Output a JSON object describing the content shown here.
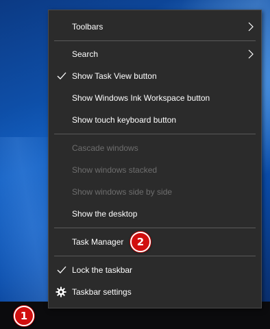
{
  "menu": {
    "items": [
      {
        "label": "Toolbars",
        "submenu": true
      },
      {
        "label": "Search",
        "submenu": true
      },
      {
        "label": "Show Task View button",
        "checked": true
      },
      {
        "label": "Show Windows Ink Workspace button"
      },
      {
        "label": "Show touch keyboard button"
      },
      {
        "label": "Cascade windows",
        "disabled": true
      },
      {
        "label": "Show windows stacked",
        "disabled": true
      },
      {
        "label": "Show windows side by side",
        "disabled": true
      },
      {
        "label": "Show the desktop"
      },
      {
        "label": "Task Manager"
      },
      {
        "label": "Lock the taskbar",
        "checked": true
      },
      {
        "label": "Taskbar settings",
        "icon": "gear-icon"
      }
    ]
  },
  "badges": {
    "taskbar_badge": "1",
    "task_manager_badge": "2"
  },
  "colors": {
    "menu_background": "#2b2b2b",
    "menu_text": "#ffffff",
    "disabled_text": "#6e6e6e",
    "badge_red": "#d10f0f",
    "taskbar": "#0b0b0d"
  }
}
